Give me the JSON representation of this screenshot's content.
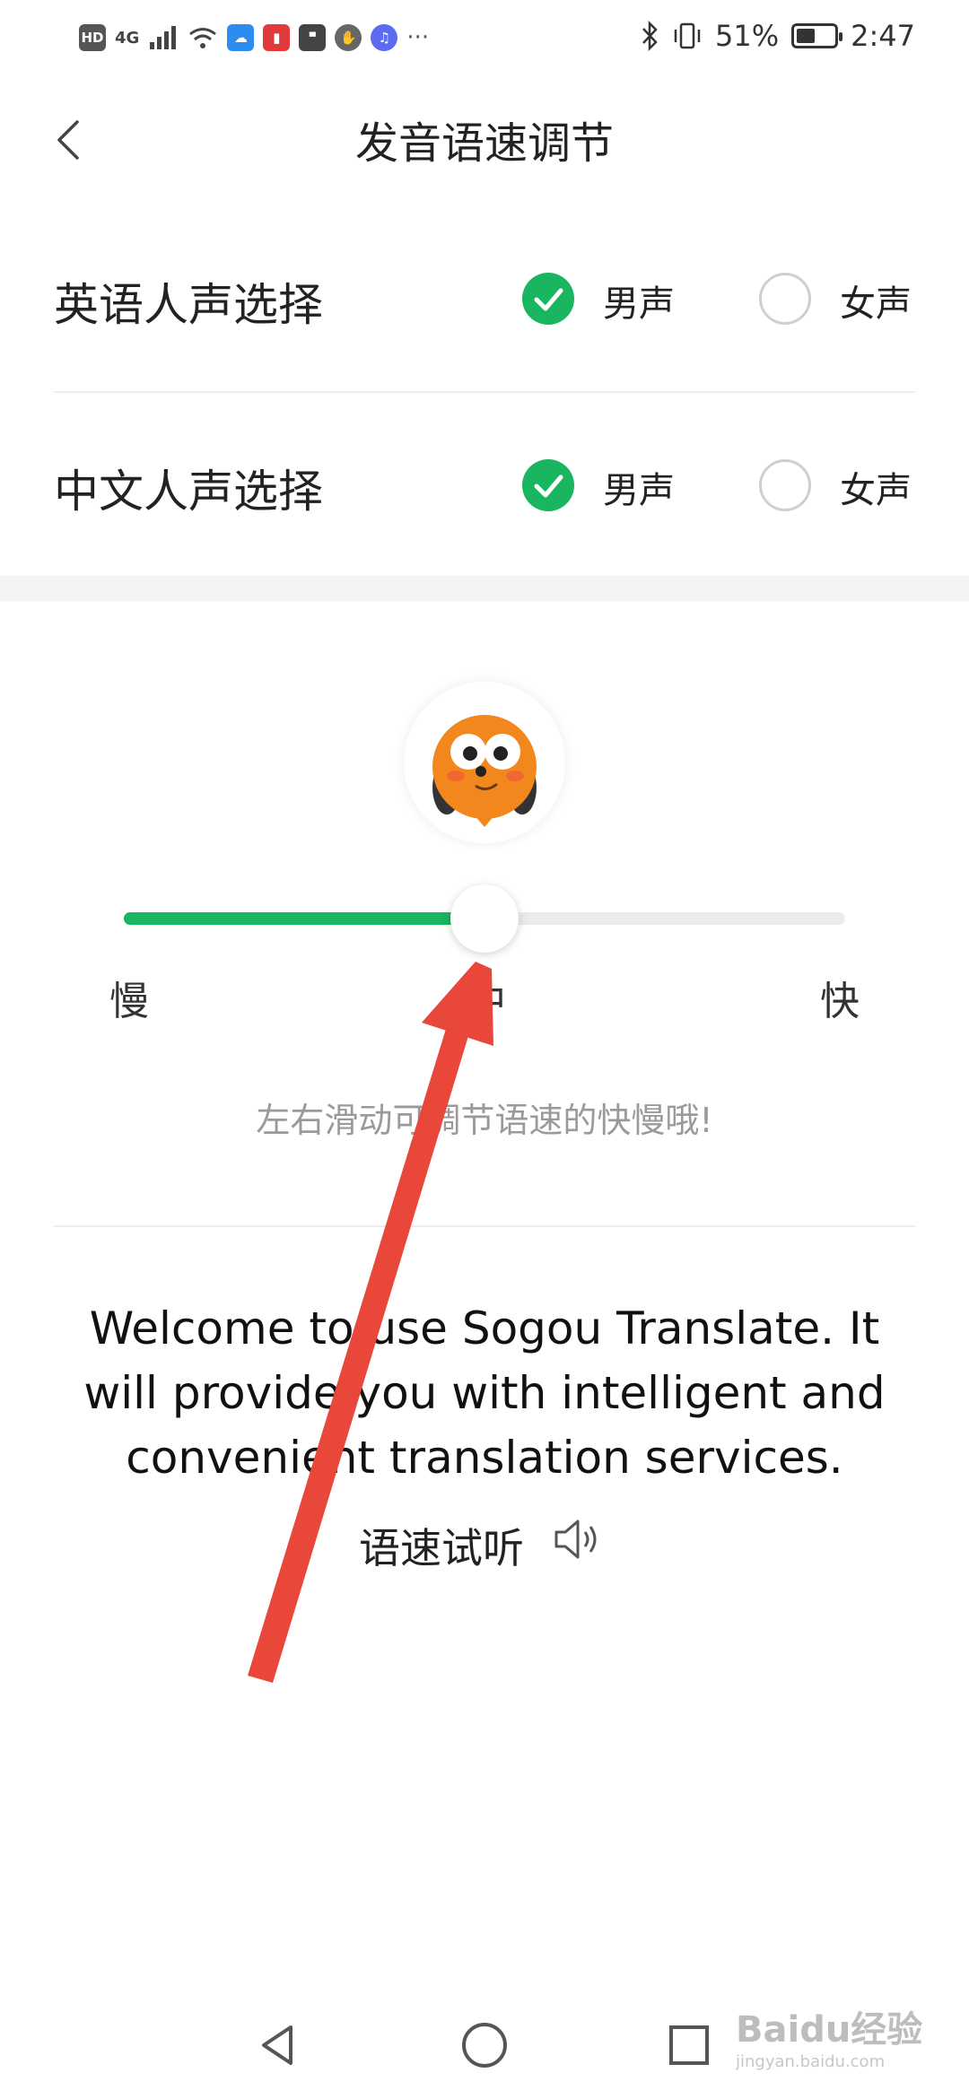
{
  "status_bar": {
    "network": "4G",
    "battery": "51%",
    "battery_level": 0.51,
    "time": "2:47"
  },
  "header": {
    "title": "发音语速调节",
    "back_icon": "chevron-left-icon"
  },
  "voice_settings": {
    "english": {
      "label": "英语人声选择",
      "options": [
        {
          "label": "男声",
          "checked": true
        },
        {
          "label": "女声",
          "checked": false
        }
      ]
    },
    "chinese": {
      "label": "中文人声选择",
      "options": [
        {
          "label": "男声",
          "checked": true
        },
        {
          "label": "女声",
          "checked": false
        }
      ]
    }
  },
  "speed_slider": {
    "min_label": "慢",
    "mid_label": "中",
    "max_label": "快",
    "value": 0.5,
    "hint": "左右滑动可调节语速的快慢哦!"
  },
  "sample": {
    "text": "Welcome to use Sogou Translate. It will provide you with intelligent and convenient translation services.",
    "listen_label": "语速试听"
  },
  "watermark": {
    "text": "Baidu经验",
    "subtext": "jingyan.baidu.com"
  },
  "colors": {
    "accent": "#19b55f",
    "arrow": "#e8473a"
  }
}
